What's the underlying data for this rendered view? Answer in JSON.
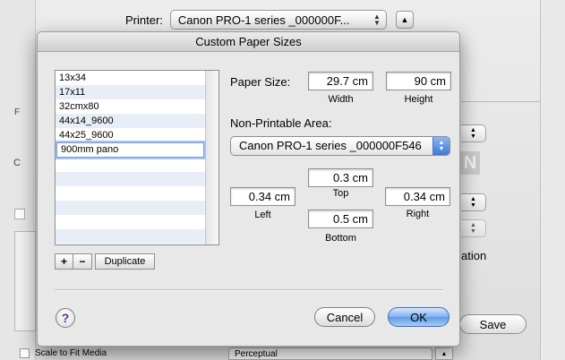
{
  "background": {
    "printer_label": "Printer:",
    "printer_value": "Canon PRO-1 series _000000F...",
    "fragment_text": "ation",
    "save_label": "Save",
    "scale_label": "Scale to Fit Media",
    "color_matching_value": "Perceptual"
  },
  "dialog": {
    "title": "Custom Paper Sizes",
    "list_items": [
      "13x34",
      "17x11",
      "32cmx80",
      "44x14_9600",
      "44x25_9600"
    ],
    "editing_item": "900mm pano",
    "buttons": {
      "add": "+",
      "remove": "−",
      "duplicate": "Duplicate",
      "help": "?",
      "cancel": "Cancel",
      "ok": "OK"
    },
    "paper_size": {
      "label": "Paper Size:",
      "width": "29.7 cm",
      "height": "90 cm",
      "width_caption": "Width",
      "height_caption": "Height"
    },
    "non_printable": {
      "label": "Non-Printable Area:",
      "printer": "Canon PRO-1 series _000000F546",
      "top": "0.3 cm",
      "left": "0.34 cm",
      "right": "0.34 cm",
      "bottom": "0.5 cm",
      "top_caption": "Top",
      "left_caption": "Left",
      "right_caption": "Right",
      "bottom_caption": "Bottom"
    }
  },
  "colors": {
    "default_button": "#6aa4ec",
    "help_glyph": "#5a2f98",
    "list_stripe": "#e8eef7"
  }
}
